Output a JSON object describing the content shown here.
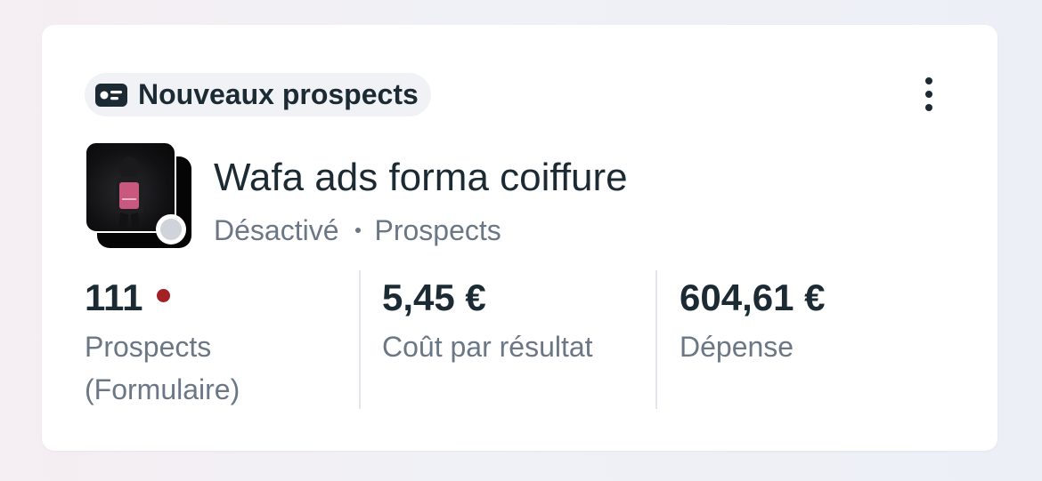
{
  "card": {
    "objective_tag": "Nouveaux prospects",
    "objective_icon": "lead-form-icon",
    "menu_icon": "more-vertical-icon"
  },
  "campaign": {
    "name": "Wafa ads forma coiffure",
    "status": "Désactivé",
    "objective": "Prospects",
    "status_color": "#cfd4db"
  },
  "metrics": [
    {
      "value": "111",
      "label": "Prospects (Formulaire)",
      "alert": true,
      "alert_color": "#a32025"
    },
    {
      "value": "5,45 €",
      "label": "Coût par résultat"
    },
    {
      "value": "604,61 €",
      "label": "Dépense"
    }
  ]
}
